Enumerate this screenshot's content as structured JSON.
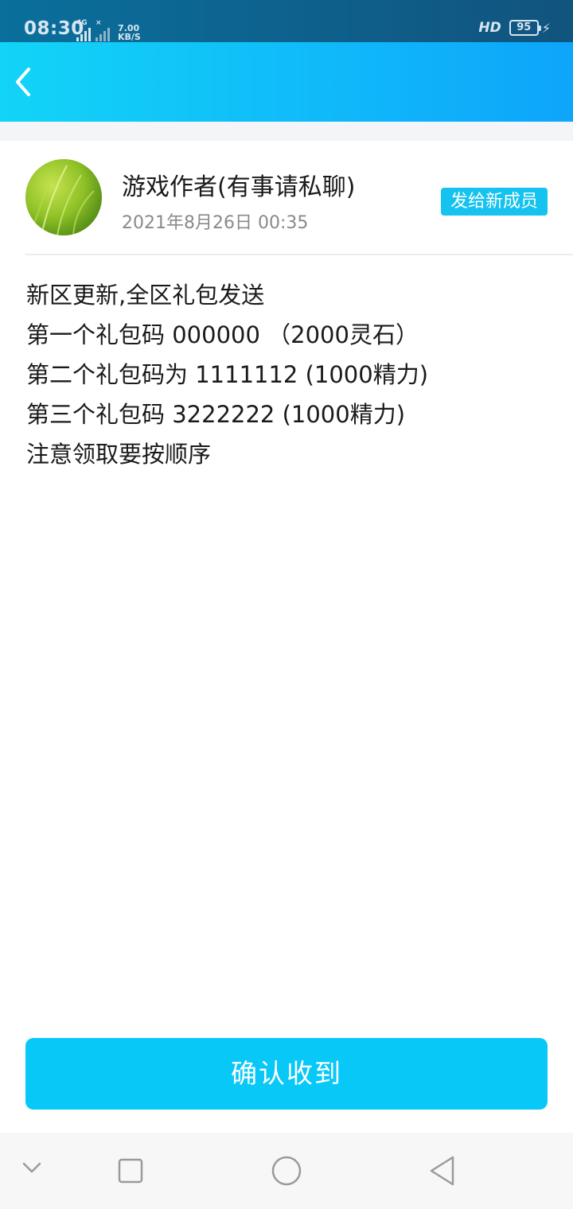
{
  "status_bar": {
    "time": "08:30",
    "network_label": "4G",
    "net_speed_value": "7.00",
    "net_speed_unit": "KB/S",
    "hd_label": "HD",
    "battery_level": "95",
    "bar_color": "#0a6f9c"
  },
  "header": {
    "back_icon": "chevron-left-icon",
    "gradient_start": "#12d4f7",
    "gradient_end": "#0ea5fb"
  },
  "notice": {
    "sender_name": "游戏作者(有事请私聊)",
    "timestamp": "2021年8月26日 00:35",
    "badge_label": "发给新成员",
    "message_lines": [
      "新区更新,全区礼包发送",
      "第一个礼包码 000000 （2000灵石）",
      "第二个礼包码为 1111112 (1000精力)",
      "第三个礼包码 3222222 (1000精力)",
      "注意领取要按顺序"
    ]
  },
  "actions": {
    "confirm_label": "确认收到",
    "accent_color": "#08c8f8"
  },
  "nav_bar": {
    "icons": [
      "chevron-down-icon",
      "square-icon",
      "circle-icon",
      "triangle-back-icon"
    ]
  }
}
